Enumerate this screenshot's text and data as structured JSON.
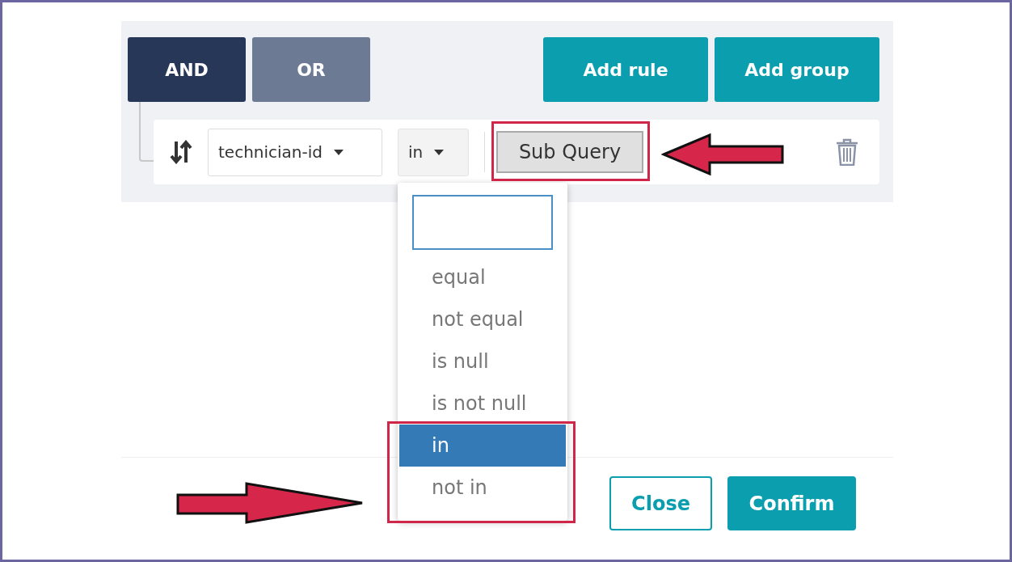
{
  "logic": [
    {
      "label": "AND",
      "selected": true
    },
    {
      "label": "OR",
      "selected": false
    }
  ],
  "actions": [
    "Add rule",
    "Add group"
  ],
  "rule": {
    "field": "technician-id",
    "operator": "in",
    "value_button": "Sub Query"
  },
  "operator_dropdown": {
    "options": [
      {
        "label": "equal",
        "selected": false
      },
      {
        "label": "not equal",
        "selected": false
      },
      {
        "label": "is null",
        "selected": false
      },
      {
        "label": "is not null",
        "selected": false
      },
      {
        "label": "in",
        "selected": true
      },
      {
        "label": "not in",
        "selected": false
      }
    ]
  },
  "footer": {
    "buttons": [
      {
        "label": "Close",
        "kind": "outline"
      },
      {
        "label": "Confirm",
        "kind": "primary"
      }
    ]
  }
}
